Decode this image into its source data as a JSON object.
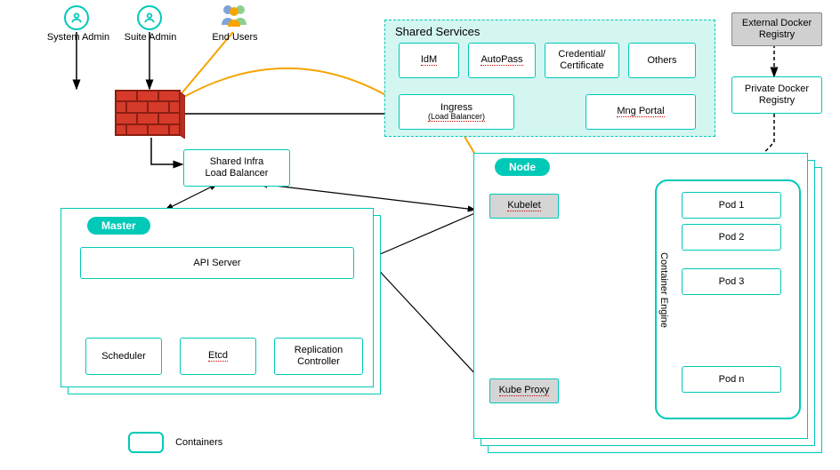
{
  "actors": {
    "sysadmin": "System Admin",
    "suiteadmin": "Suite Admin",
    "endusers": "End Users"
  },
  "shared_services": {
    "title": "Shared Services",
    "items": [
      "IdM",
      "AutoPass",
      "Credential/\nCertificate",
      "Others"
    ],
    "ingress": "Ingress",
    "ingress_sub": "(Load Balancer)",
    "mng_portal": "Mng Portal"
  },
  "external_docker": "External Docker Registry",
  "private_docker": "Private Docker\nRegistry",
  "shared_infra": "Shared Infra\nLoad Balancer",
  "master": {
    "title": "Master",
    "api": "API Server",
    "scheduler": "Scheduler",
    "etcd": "Etcd",
    "replication": "Replication\nController"
  },
  "node": {
    "title": "Node",
    "kubelet": "Kubelet",
    "kubeproxy": "Kube Proxy",
    "container_engine": "Container Engine",
    "pods": [
      "Pod 1",
      "Pod 2",
      "Pod 3",
      "Pod n"
    ]
  },
  "legend": "Containers"
}
